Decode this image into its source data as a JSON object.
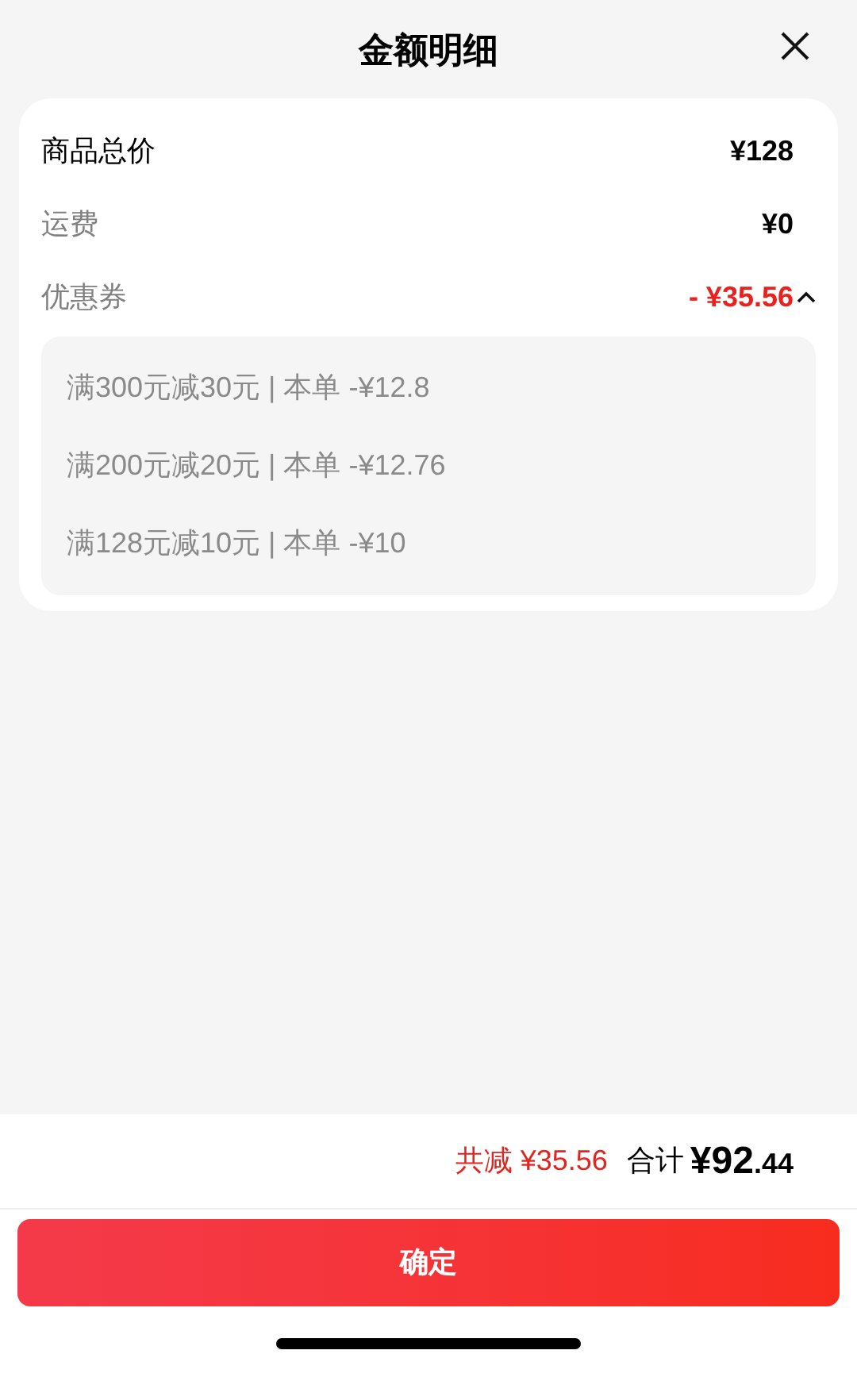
{
  "header": {
    "title": "金额明细"
  },
  "rows": [
    {
      "kind": "plain",
      "label": "商品总价",
      "value": "¥128",
      "emphasis": true
    },
    {
      "kind": "plain",
      "label": "运费",
      "value": "¥0",
      "emphasis": false
    },
    {
      "kind": "coupon",
      "label": "优惠券",
      "value": "- ¥35.56",
      "emphasis": false,
      "expanded": true,
      "coupons": [
        "满300元减30元 | 本单 -¥12.8",
        "满200元减20元 | 本单 -¥12.76",
        "满128元减10元 | 本单 -¥10"
      ]
    }
  ],
  "summary": {
    "discount": "共减 ¥35.56",
    "total_label": "合计",
    "total": "¥92.44"
  },
  "confirm_button": "确定"
}
